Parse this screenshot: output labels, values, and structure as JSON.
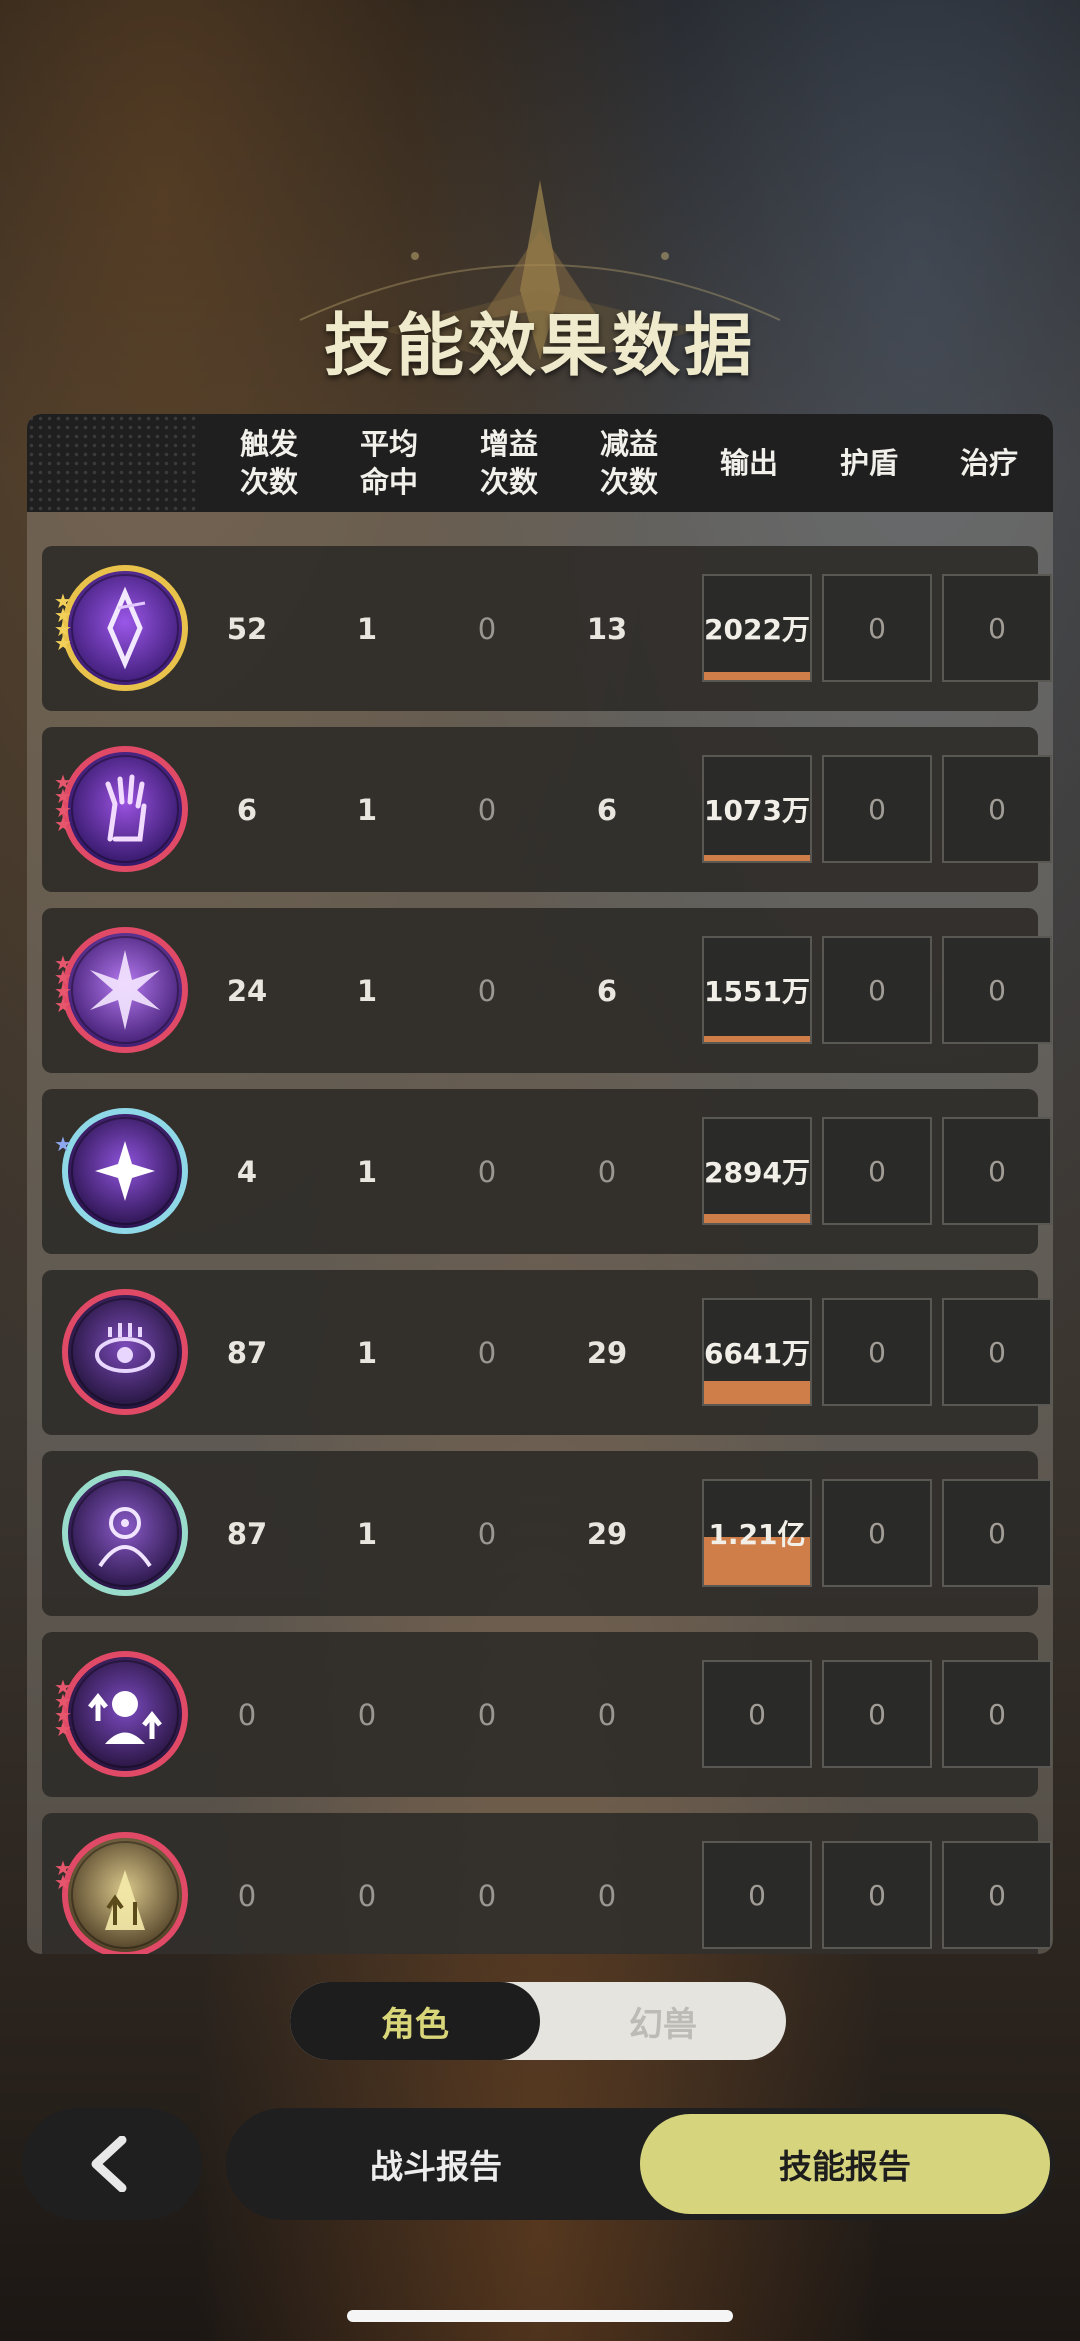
{
  "title": "技能效果数据",
  "columns": [
    {
      "l1": "触发",
      "l2": "次数"
    },
    {
      "l1": "平均",
      "l2": "命中"
    },
    {
      "l1": "增益",
      "l2": "次数"
    },
    {
      "l1": "减益",
      "l2": "次数"
    },
    {
      "l1": "输出",
      "l2": ""
    },
    {
      "l1": "护盾",
      "l2": ""
    },
    {
      "l1": "治疗",
      "l2": ""
    }
  ],
  "rows": [
    {
      "icon": "diamond-star-skill-icon",
      "ring": "#e8c24a",
      "stars": 4,
      "star_color": "#f3d05a",
      "trigger": "52",
      "hit": "1",
      "buff": "0",
      "debuff": "13",
      "output": "2022万",
      "output_fill": 0.08,
      "shield": "0",
      "heal": "0"
    },
    {
      "icon": "grasping-hand-skill-icon",
      "ring": "#e04a66",
      "stars": 4,
      "star_color": "#e6566c",
      "trigger": "6",
      "hit": "1",
      "buff": "0",
      "debuff": "6",
      "output": "1073万",
      "output_fill": 0.05,
      "shield": "0",
      "heal": "0"
    },
    {
      "icon": "burst-skill-icon",
      "ring": "#e04a66",
      "stars": 4,
      "star_color": "#e6566c",
      "trigger": "24",
      "hit": "1",
      "buff": "0",
      "debuff": "6",
      "output": "1551万",
      "output_fill": 0.06,
      "shield": "0",
      "heal": "0"
    },
    {
      "icon": "four-point-star-skill-icon",
      "ring": "#8fd8e8",
      "stars": 1,
      "star_color": "#8da8f0",
      "trigger": "4",
      "hit": "1",
      "buff": "0",
      "debuff": "0",
      "output": "2894万",
      "output_fill": 0.09,
      "shield": "0",
      "heal": "0"
    },
    {
      "icon": "eye-sigil-skill-icon",
      "ring": "#e04a66",
      "stars": 0,
      "star_color": "#e6566c",
      "trigger": "87",
      "hit": "1",
      "buff": "0",
      "debuff": "29",
      "output": "6641万",
      "output_fill": 0.22,
      "shield": "0",
      "heal": "0"
    },
    {
      "icon": "veiled-figure-skill-icon",
      "ring": "#9adccb",
      "stars": 0,
      "star_color": "#e6566c",
      "trigger": "87",
      "hit": "1",
      "buff": "0",
      "debuff": "29",
      "output": "1.21亿",
      "output_fill": 0.46,
      "shield": "0",
      "heal": "0"
    },
    {
      "icon": "figure-arrows-skill-icon",
      "ring": "#e04a66",
      "stars": 4,
      "star_color": "#e6566c",
      "trigger": "0",
      "hit": "0",
      "buff": "0",
      "debuff": "0",
      "output": "0",
      "output_fill": 0,
      "shield": "0",
      "heal": "0"
    },
    {
      "icon": "golden-light-skill-icon",
      "ring": "#e04a66",
      "stars": 2,
      "star_color": "#e6566c",
      "trigger": "0",
      "hit": "0",
      "buff": "0",
      "debuff": "0",
      "output": "0",
      "output_fill": 0,
      "shield": "0",
      "heal": "0"
    }
  ],
  "toggle": {
    "active": "角色",
    "inactive": "幻兽"
  },
  "bottom": {
    "battle_report": "战斗报告",
    "skill_report": "技能报告"
  },
  "colors": {
    "accent": "#d6d47c",
    "output_bar": "#cf7e4a"
  }
}
